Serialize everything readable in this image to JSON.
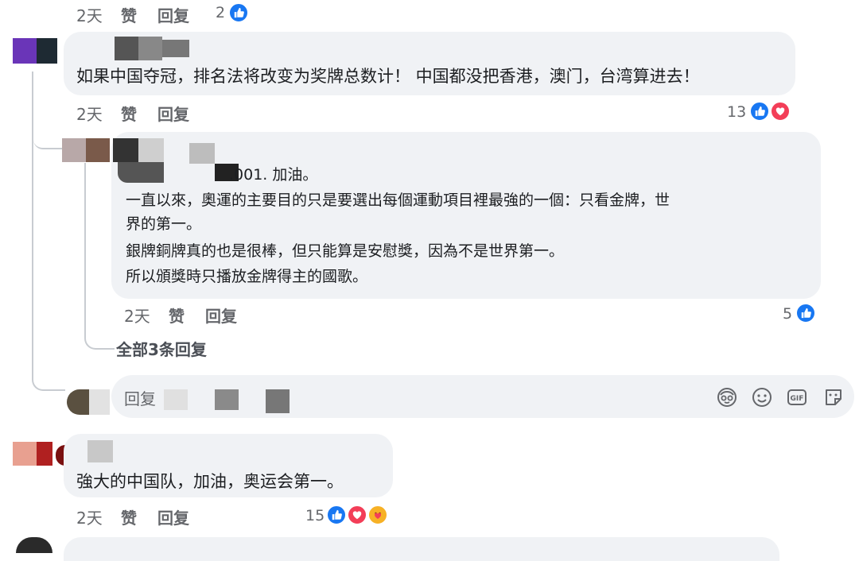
{
  "top_meta": {
    "time": "2天",
    "like": "赞",
    "reply": "回复",
    "reaction_count": "2"
  },
  "comment1": {
    "text": "如果中国夺冠，排名法将改变为奖牌总数计！ 中国都没把香港，澳门，台湾算进去！",
    "time": "2天",
    "like": "赞",
    "reply": "回复",
    "reaction_count": "13"
  },
  "reply1": {
    "first_line_tail": ".001. 加油。",
    "lines": [
      "一直以來，奧運的主要目的只是要選出每個運動項目裡最強的一個：只看金牌，世",
      "界的第一。",
      "銀牌銅牌真的也是很棒，但只能算是安慰獎，因為不是世界第一。",
      "所以頒獎時只播放金牌得主的國歌。"
    ],
    "time": "2天",
    "like": "赞",
    "reply": "回复",
    "reaction_count": "5"
  },
  "view_all_replies": "全部3条回复",
  "reply_box": {
    "placeholder": "回复"
  },
  "comment2": {
    "text": "強大的中国队，加油，奥运会第一。",
    "time": "2天",
    "like": "赞",
    "reply": "回复",
    "reaction_count": "15"
  },
  "colors": {
    "like_blue": "#1877f2",
    "love_red": "#f33e58",
    "haha_yellow": "#f7b125",
    "bubble": "#f0f2f5"
  },
  "icons": [
    "like-icon",
    "love-icon",
    "care-icon",
    "avatar-icon",
    "sticker-icon",
    "emoji-icon",
    "gif-icon",
    "stickers-icon"
  ]
}
